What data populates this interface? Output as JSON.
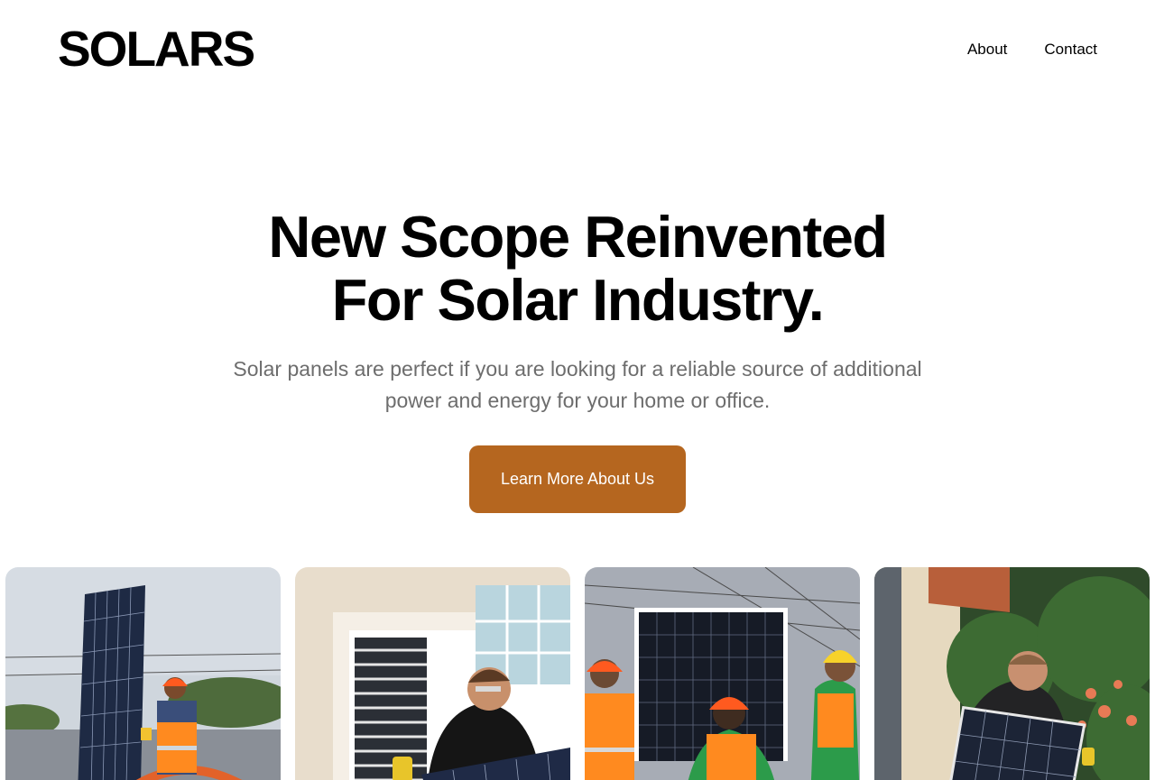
{
  "header": {
    "logo": "SOLARS",
    "nav": [
      {
        "label": "About"
      },
      {
        "label": "Contact"
      }
    ]
  },
  "hero": {
    "title_lines": [
      "New Scope Reinvented",
      "For Solar Industry."
    ],
    "subtitle_lines": [
      "Solar panels are perfect if you are looking for a reliable source of additional",
      "power and energy for your home or office."
    ],
    "cta_label": "Learn More About Us"
  },
  "gallery": {
    "images": [
      {
        "name": "worker-lifting-panel-photo"
      },
      {
        "name": "worker-installing-panel-window-photo"
      },
      {
        "name": "workers-carrying-panel-photo"
      },
      {
        "name": "man-carrying-panel-garden-photo"
      }
    ]
  },
  "colors": {
    "accent": "#b5661f",
    "text": "#000000",
    "muted": "#6d6d6d",
    "background": "#ffffff"
  }
}
